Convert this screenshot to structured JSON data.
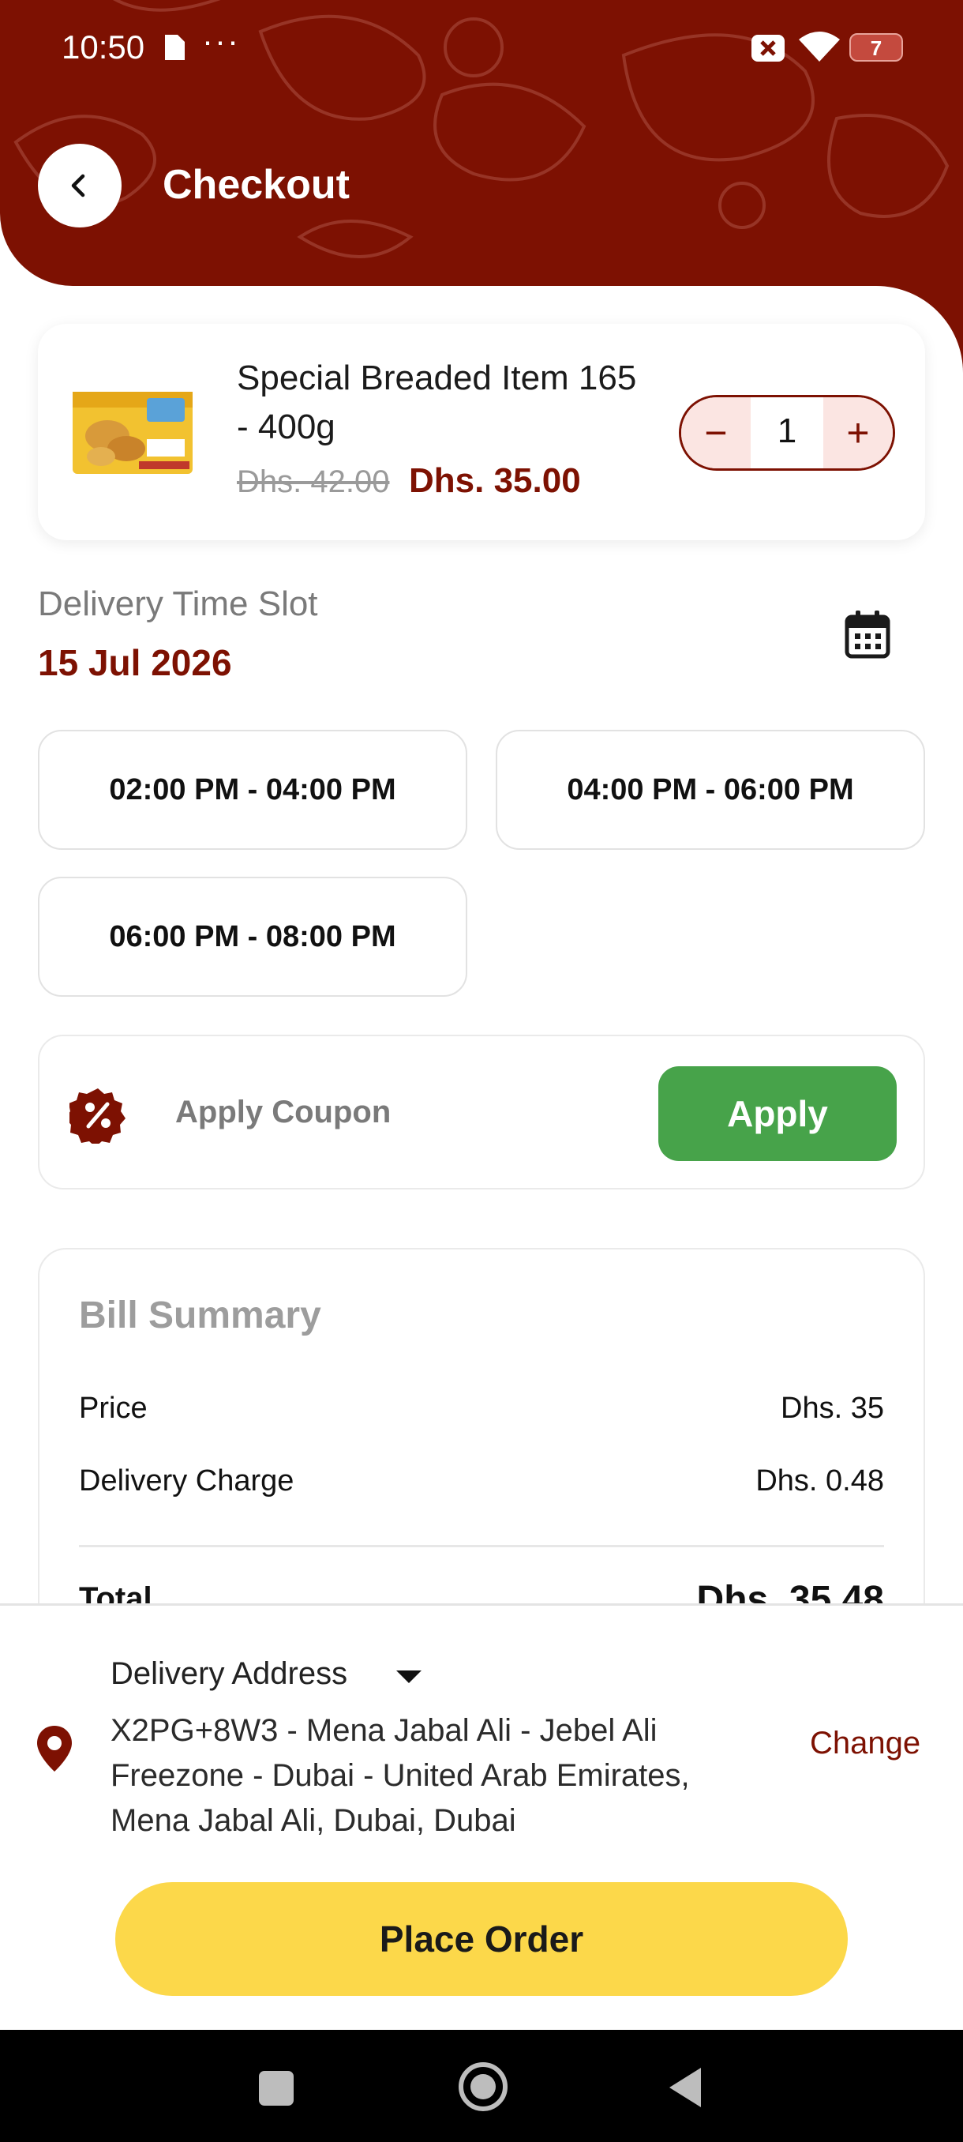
{
  "status_bar": {
    "time": "10:50",
    "dots": "···",
    "battery": "7"
  },
  "header": {
    "title": "Checkout"
  },
  "product": {
    "name": "Special Breaded Item 165 - 400g",
    "old_price": "Dhs. 42.00",
    "new_price": "Dhs. 35.00",
    "quantity": "1",
    "minus": "−",
    "plus": "+"
  },
  "delivery": {
    "label": "Delivery Time Slot",
    "date": "15 Jul 2026",
    "slots": [
      "02:00 PM - 04:00 PM",
      "04:00 PM - 06:00 PM",
      "06:00 PM - 08:00 PM"
    ]
  },
  "coupon": {
    "placeholder": "Apply Coupon",
    "button": "Apply"
  },
  "bill": {
    "title": "Bill Summary",
    "rows": [
      {
        "label": "Price",
        "value": "Dhs. 35"
      },
      {
        "label": "Delivery Charge",
        "value": "Dhs. 0.48"
      }
    ],
    "total_label": "Total",
    "total_value": "Dhs. 35.48"
  },
  "address": {
    "heading": "Delivery Address",
    "text": "X2PG+8W3 - Mena Jabal Ali - Jebel Ali Freezone - Dubai - United Arab Emirates, Mena Jabal Ali, Dubai, Dubai",
    "change": "Change"
  },
  "place_order": "Place Order",
  "colors": {
    "brand": "#7d1102",
    "apply": "#47a34a",
    "cta": "#fcd84a"
  }
}
